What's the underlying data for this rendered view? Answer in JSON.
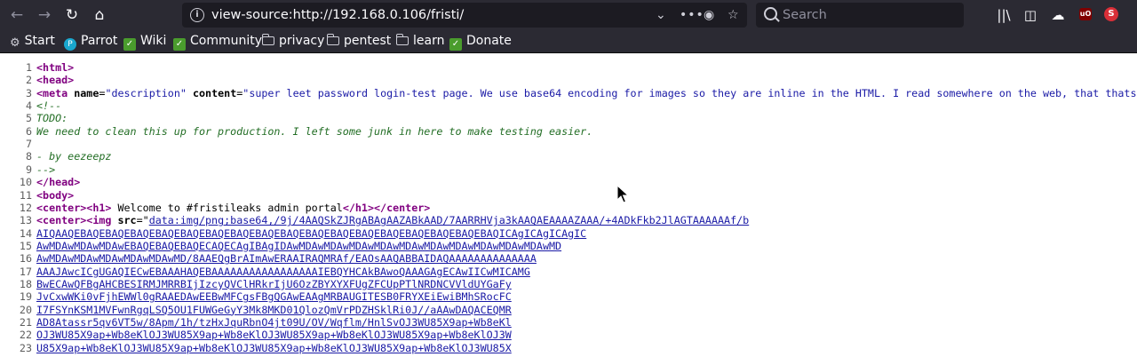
{
  "browser": {
    "url": "view-source:http://192.168.0.106/fristi/",
    "search_placeholder": "Search"
  },
  "bookmarks": [
    {
      "label": "Start",
      "icon": "gear-icon"
    },
    {
      "label": "Parrot",
      "icon": "parrot-icon"
    },
    {
      "label": "Wiki",
      "icon": "wiki-icon"
    },
    {
      "label": "Community",
      "icon": "community-icon"
    },
    {
      "label": "privacy",
      "icon": "folder-icon"
    },
    {
      "label": "pentest",
      "icon": "folder-icon"
    },
    {
      "label": "learn",
      "icon": "folder-icon"
    },
    {
      "label": "Donate",
      "icon": "donate-icon"
    }
  ],
  "source_lines": [
    {
      "n": "1",
      "tag": "<html>"
    },
    {
      "n": "2",
      "tag": "<head>"
    },
    {
      "n": "3",
      "tag_open": "<meta ",
      "a1": "name",
      "e1": "=",
      "v1": "\"description\"",
      "sp": " ",
      "a2": "content",
      "e2": "=",
      "v2": "\"super leet password login-test page. We use base64 encoding for images so they are inline in the HTML. I read somewhere on the web, that thats a good w"
    },
    {
      "n": "4",
      "comment": "<!--"
    },
    {
      "n": "5",
      "comment": "TODO:"
    },
    {
      "n": "6",
      "comment": "We need to clean this up for production. I left some junk in here to make testing easier."
    },
    {
      "n": "7",
      "comment": ""
    },
    {
      "n": "8",
      "comment": "- by eezeepz"
    },
    {
      "n": "9",
      "comment": "-->"
    },
    {
      "n": "10",
      "tag": "</head>"
    },
    {
      "n": "11",
      "tag": "<body>"
    },
    {
      "n": "12",
      "t1": "<center>",
      "t2": "<h1>",
      "text": " Welcome to #fristileaks admin portal",
      "t3": "</h1>",
      "t4": "</center>"
    },
    {
      "n": "13",
      "t1": "<center>",
      "t2": "<img ",
      "a1": "src",
      "e1": "=\"",
      "link": "data:img/png;base64,/9j/4AAQSkZJRgABAgAAZABkAAD/7AARRHVja3kAAQAEAAAAZAAA/+4ADkFkb2JlAGTAAAAAAf/b"
    },
    {
      "n": "14",
      "link": "AIQAAQEBAQEBAQEBAQEBAQEBAQEBAQEBAQEBAQEBAQEBAQEBAQEBAQEBAQEBAQEBAQEBAQEBAQICAgICAgICAgIC"
    },
    {
      "n": "15",
      "link": "AwMDAwMDAwMDAwEBAQEBAQEBAQECAQECAgIBAgIDAwMDAwMDAwMDAwMDAwMDAwMDAwMDAwMDAwMDAwMDAwMD"
    },
    {
      "n": "16",
      "link": "AwMDAwMDAwMDAwMDAwMDAwMD/8AAEQgBrAImAwERAAIRAQMRAf/EAOsAAQABBAIDAQAAAAAAAAAAAAAA"
    },
    {
      "n": "17",
      "link": "AAAJAwcICgUGAQIECwEBAAAHAQEBAAAAAAAAAAAAAAAAAIEBQYHCAkBAwoQAAAGAgECAwIICwMICAMG"
    },
    {
      "n": "18",
      "link": "BwECAwQFBgAHCBESIRMJMRRBIjIzcyQVClHRkrIjU6OzZBYXYXFUgZFCUpPTlNRDNCVVldUYGaFy"
    },
    {
      "n": "19",
      "link": "JvCxwWKi0vFjhEWWl0gRAAEDAwEEBwMFCgsFBgQGAwEAAgMRBAUGITESB0FRYXEiEwiBMhSRocFC"
    },
    {
      "n": "20",
      "link": "I7FSYnKSM1MVFwnRgqLSQ5OU1FUWGeGyY3Mk8MKD01QlozQmVrPDZHSklRi0J//aAAwDAQACEQMR"
    },
    {
      "n": "21",
      "link": "AD8Atassr5qv6VT5w/8Apm/1h/tzHxJquRbnO4jt09U/OV/Wqflm/HnlSvOJ3WU85X9ap+Wb8eKl"
    },
    {
      "n": "22",
      "link": "OJ3WU85X9ap+Wb8eKlOJ3WU85X9ap+Wb8eKlOJ3WU85X9ap+Wb8eKlOJ3WU85X9ap+Wb8eKlOJ3W"
    },
    {
      "n": "23",
      "link": "U85X9ap+Wb8eKlOJ3WU85X9ap+Wb8eKlOJ3WU85X9ap+Wb8eKlOJ3WU85X9ap+Wb8eKlOJ3WU85X"
    }
  ]
}
